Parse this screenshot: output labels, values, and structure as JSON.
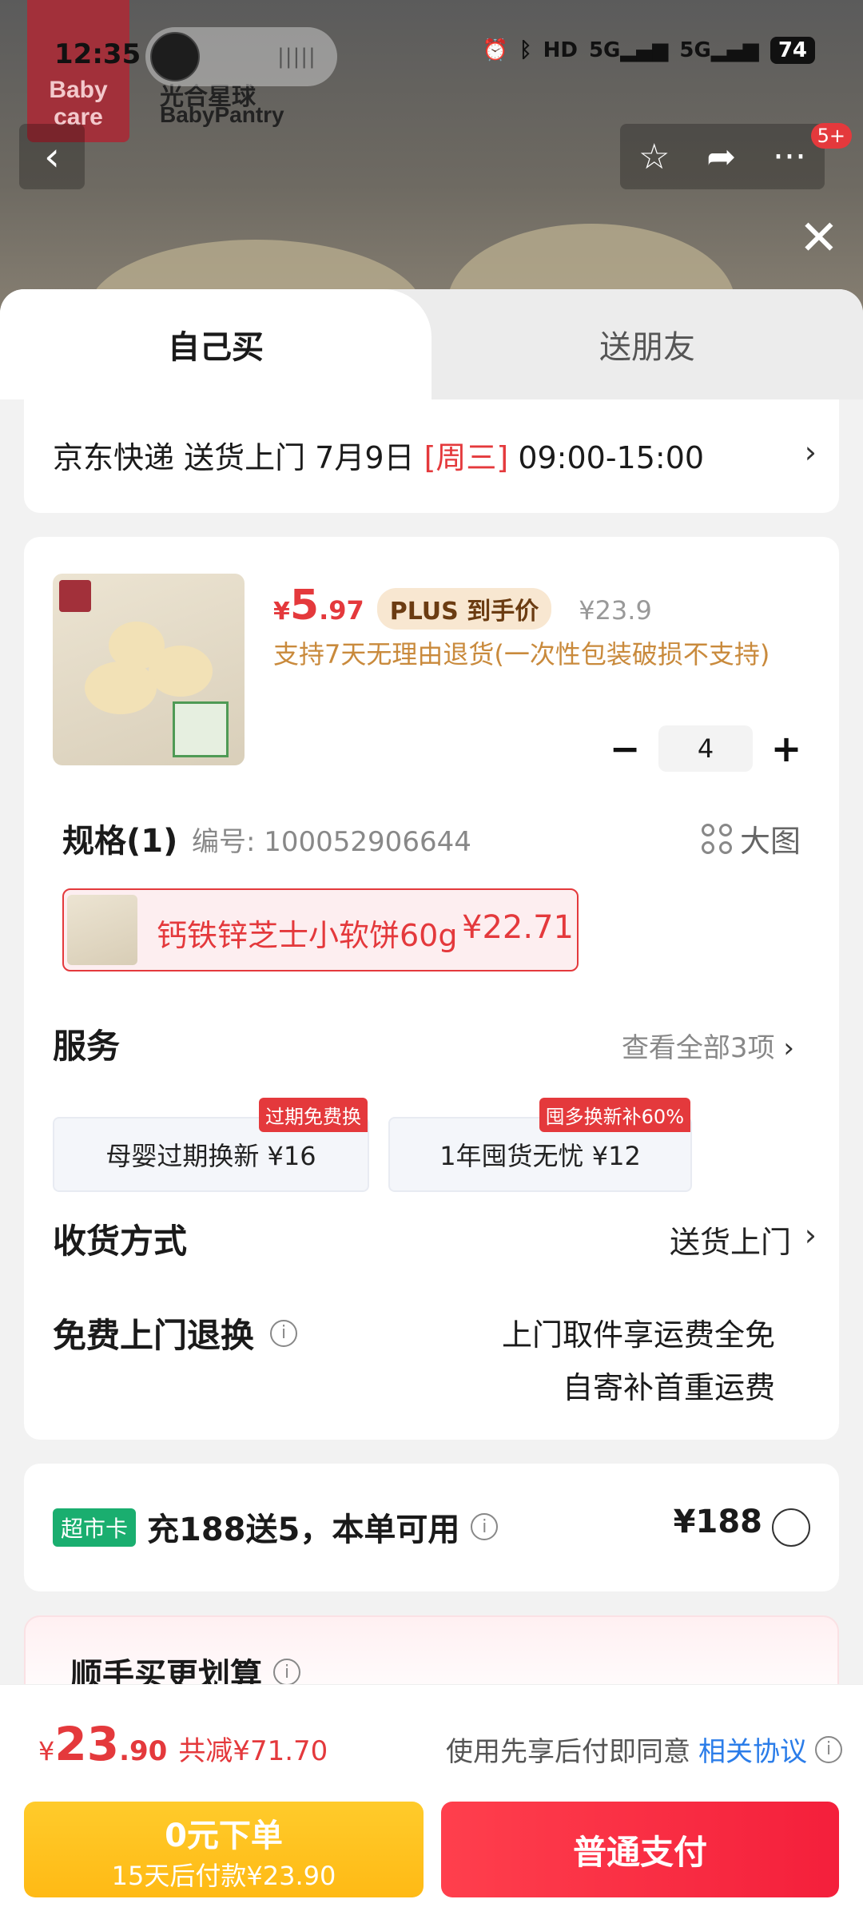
{
  "status_bar": {
    "time": "12:35",
    "network_1": "5G",
    "network_2": "5G",
    "hd": "HD",
    "battery": "74"
  },
  "brand": {
    "logo_line1": "Baby",
    "logo_line2": "care",
    "name_cn": "光合星球",
    "name_en": "BabyPantry"
  },
  "top_actions": {
    "badge": "5+"
  },
  "tabs": {
    "self": "自己买",
    "friend": "送朋友"
  },
  "delivery": {
    "carrier": "京东快递 送货上门 7月9日 ",
    "weekday": "[周三]",
    "window": " 09:00-15:00"
  },
  "product": {
    "currency": "¥",
    "price_int": "5",
    "price_dec": ".97",
    "plus_tag": "PLUS 到手价",
    "orig_price": "¥23.9",
    "refund_note": "支持7天无理由退货(一次性包装破损不支持)",
    "quantity": "4",
    "minus": "−",
    "plus": "+"
  },
  "spec": {
    "title": "规格(1)",
    "code": "编号: 100052906644",
    "big_view": "大图",
    "sku_label": "钙铁锌芝士小软饼60g",
    "sku_price": "¥22.71"
  },
  "services": {
    "title": "服务",
    "view_all": "查看全部3项",
    "items": [
      {
        "label": "母婴过期换新  ¥16",
        "tag": "过期免费换"
      },
      {
        "label": "1年囤货无忧  ¥12",
        "tag": "囤多换新补60%"
      }
    ]
  },
  "receive": {
    "title": "收货方式",
    "value": "送货上门"
  },
  "return": {
    "title": "免费上门退换",
    "line1": "上门取件享运费全免",
    "line2": "自寄补首重运费"
  },
  "club": {
    "tag": "超市卡",
    "text": "充188送5，本单可用",
    "price": "¥188"
  },
  "more": {
    "title": "顺手买更划算"
  },
  "footer": {
    "currency": "¥",
    "total_int": "23",
    "total_dec": ".90",
    "discount": "共减¥71.70",
    "agree_text": "使用先享后付即同意",
    "agree_link": "相关协议",
    "bnpl_line1": "0元下单",
    "bnpl_line2": "15天后付款¥23.90",
    "pay_label": "普通支付"
  },
  "colors": {
    "accent_red": "#e4393c",
    "bnpl_yellow": "#ffc01f",
    "club_green": "#1aae6f",
    "link_blue": "#2b7de9"
  }
}
